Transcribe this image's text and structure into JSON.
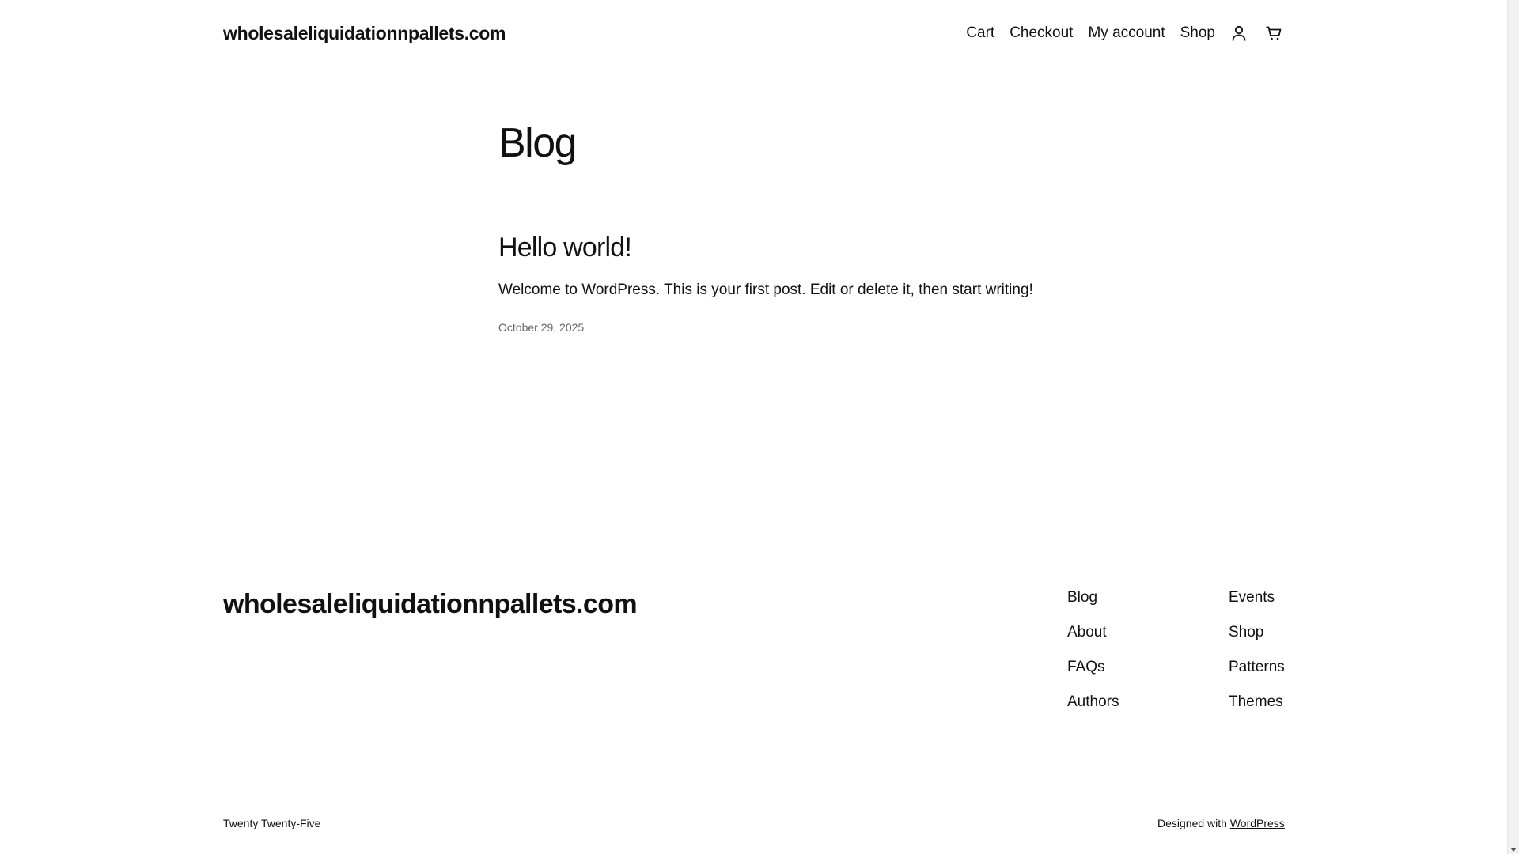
{
  "header": {
    "site_title": "wholesaleliquidationnpallets.com",
    "nav": [
      "Cart",
      "Checkout",
      "My account",
      "Shop"
    ]
  },
  "main": {
    "heading": "Blog",
    "post": {
      "title": "Hello world!",
      "excerpt": "Welcome to WordPress. This is your first post. Edit or delete it, then start writing!",
      "date": "October 29, 2025"
    }
  },
  "footer": {
    "site_title": "wholesaleliquidationnpallets.com",
    "col1": [
      "Blog",
      "About",
      "FAQs",
      "Authors"
    ],
    "col2": [
      "Events",
      "Shop",
      "Patterns",
      "Themes"
    ],
    "theme_credit": "Twenty Twenty-Five",
    "designed_with": "Designed with",
    "wp_link": "WordPress"
  },
  "icons": {
    "account": "user-icon",
    "cart": "cart-icon"
  }
}
